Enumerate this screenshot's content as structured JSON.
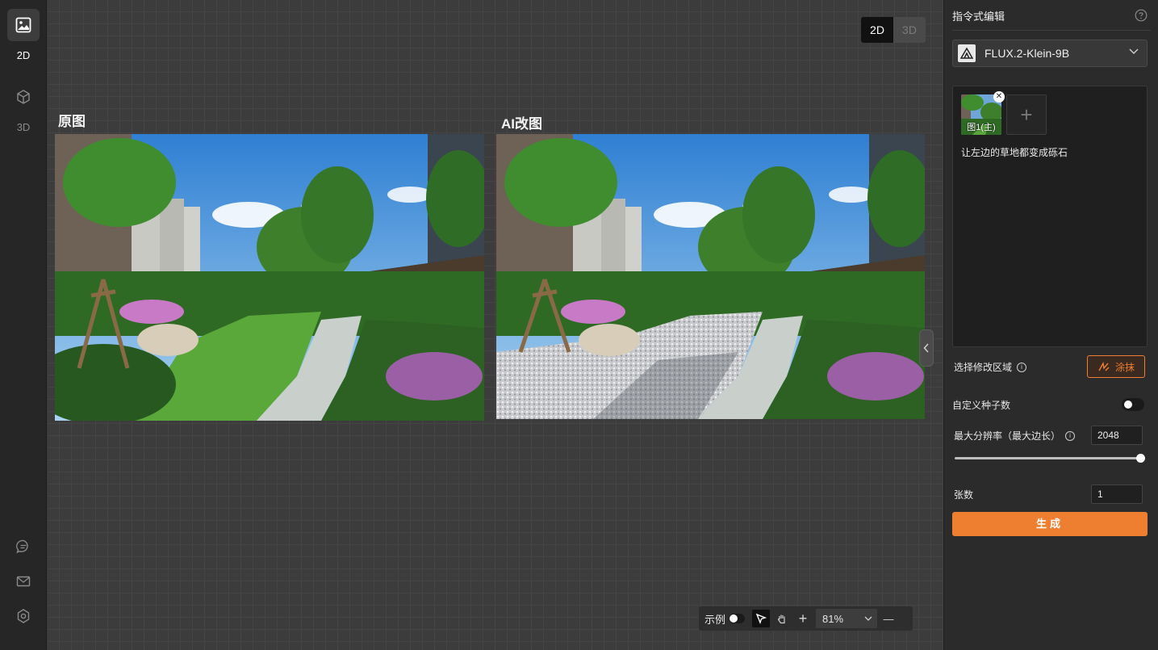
{
  "rail": {
    "items": [
      {
        "label": "2D",
        "icon": "image-icon",
        "active": true
      },
      {
        "label": "3D",
        "icon": "cube-icon",
        "active": false
      }
    ],
    "bottom_icons": [
      "chat-icon",
      "mail-icon",
      "settings-icon"
    ]
  },
  "canvas": {
    "dim_toggle": {
      "options": [
        "2D",
        "3D"
      ],
      "selected": "2D"
    },
    "original_title": "原图",
    "ai_title": "AI改图",
    "toolbar": {
      "example_label": "示例",
      "zoom": "81%",
      "plus": "+",
      "minus": "—"
    }
  },
  "panel": {
    "title": "指令式编辑",
    "model": "FLUX.2-Klein-9B",
    "thumb_label": "图1(主)",
    "prompt": "让左边的草地都变成砾石",
    "region_label": "选择修改区域",
    "brush_label": "涂抹",
    "seed_label": "自定义种子数",
    "max_res_label": "最大分辨率（最大边长）",
    "max_res_value": "2048",
    "max_res_slider_fraction": 1.0,
    "count_label": "张数",
    "count_value": "1",
    "generate_label": "生成"
  },
  "colors": {
    "accent": "#ee7f31",
    "panel_bg": "#2b2b2b",
    "canvas_bg": "#3c3c3c"
  }
}
